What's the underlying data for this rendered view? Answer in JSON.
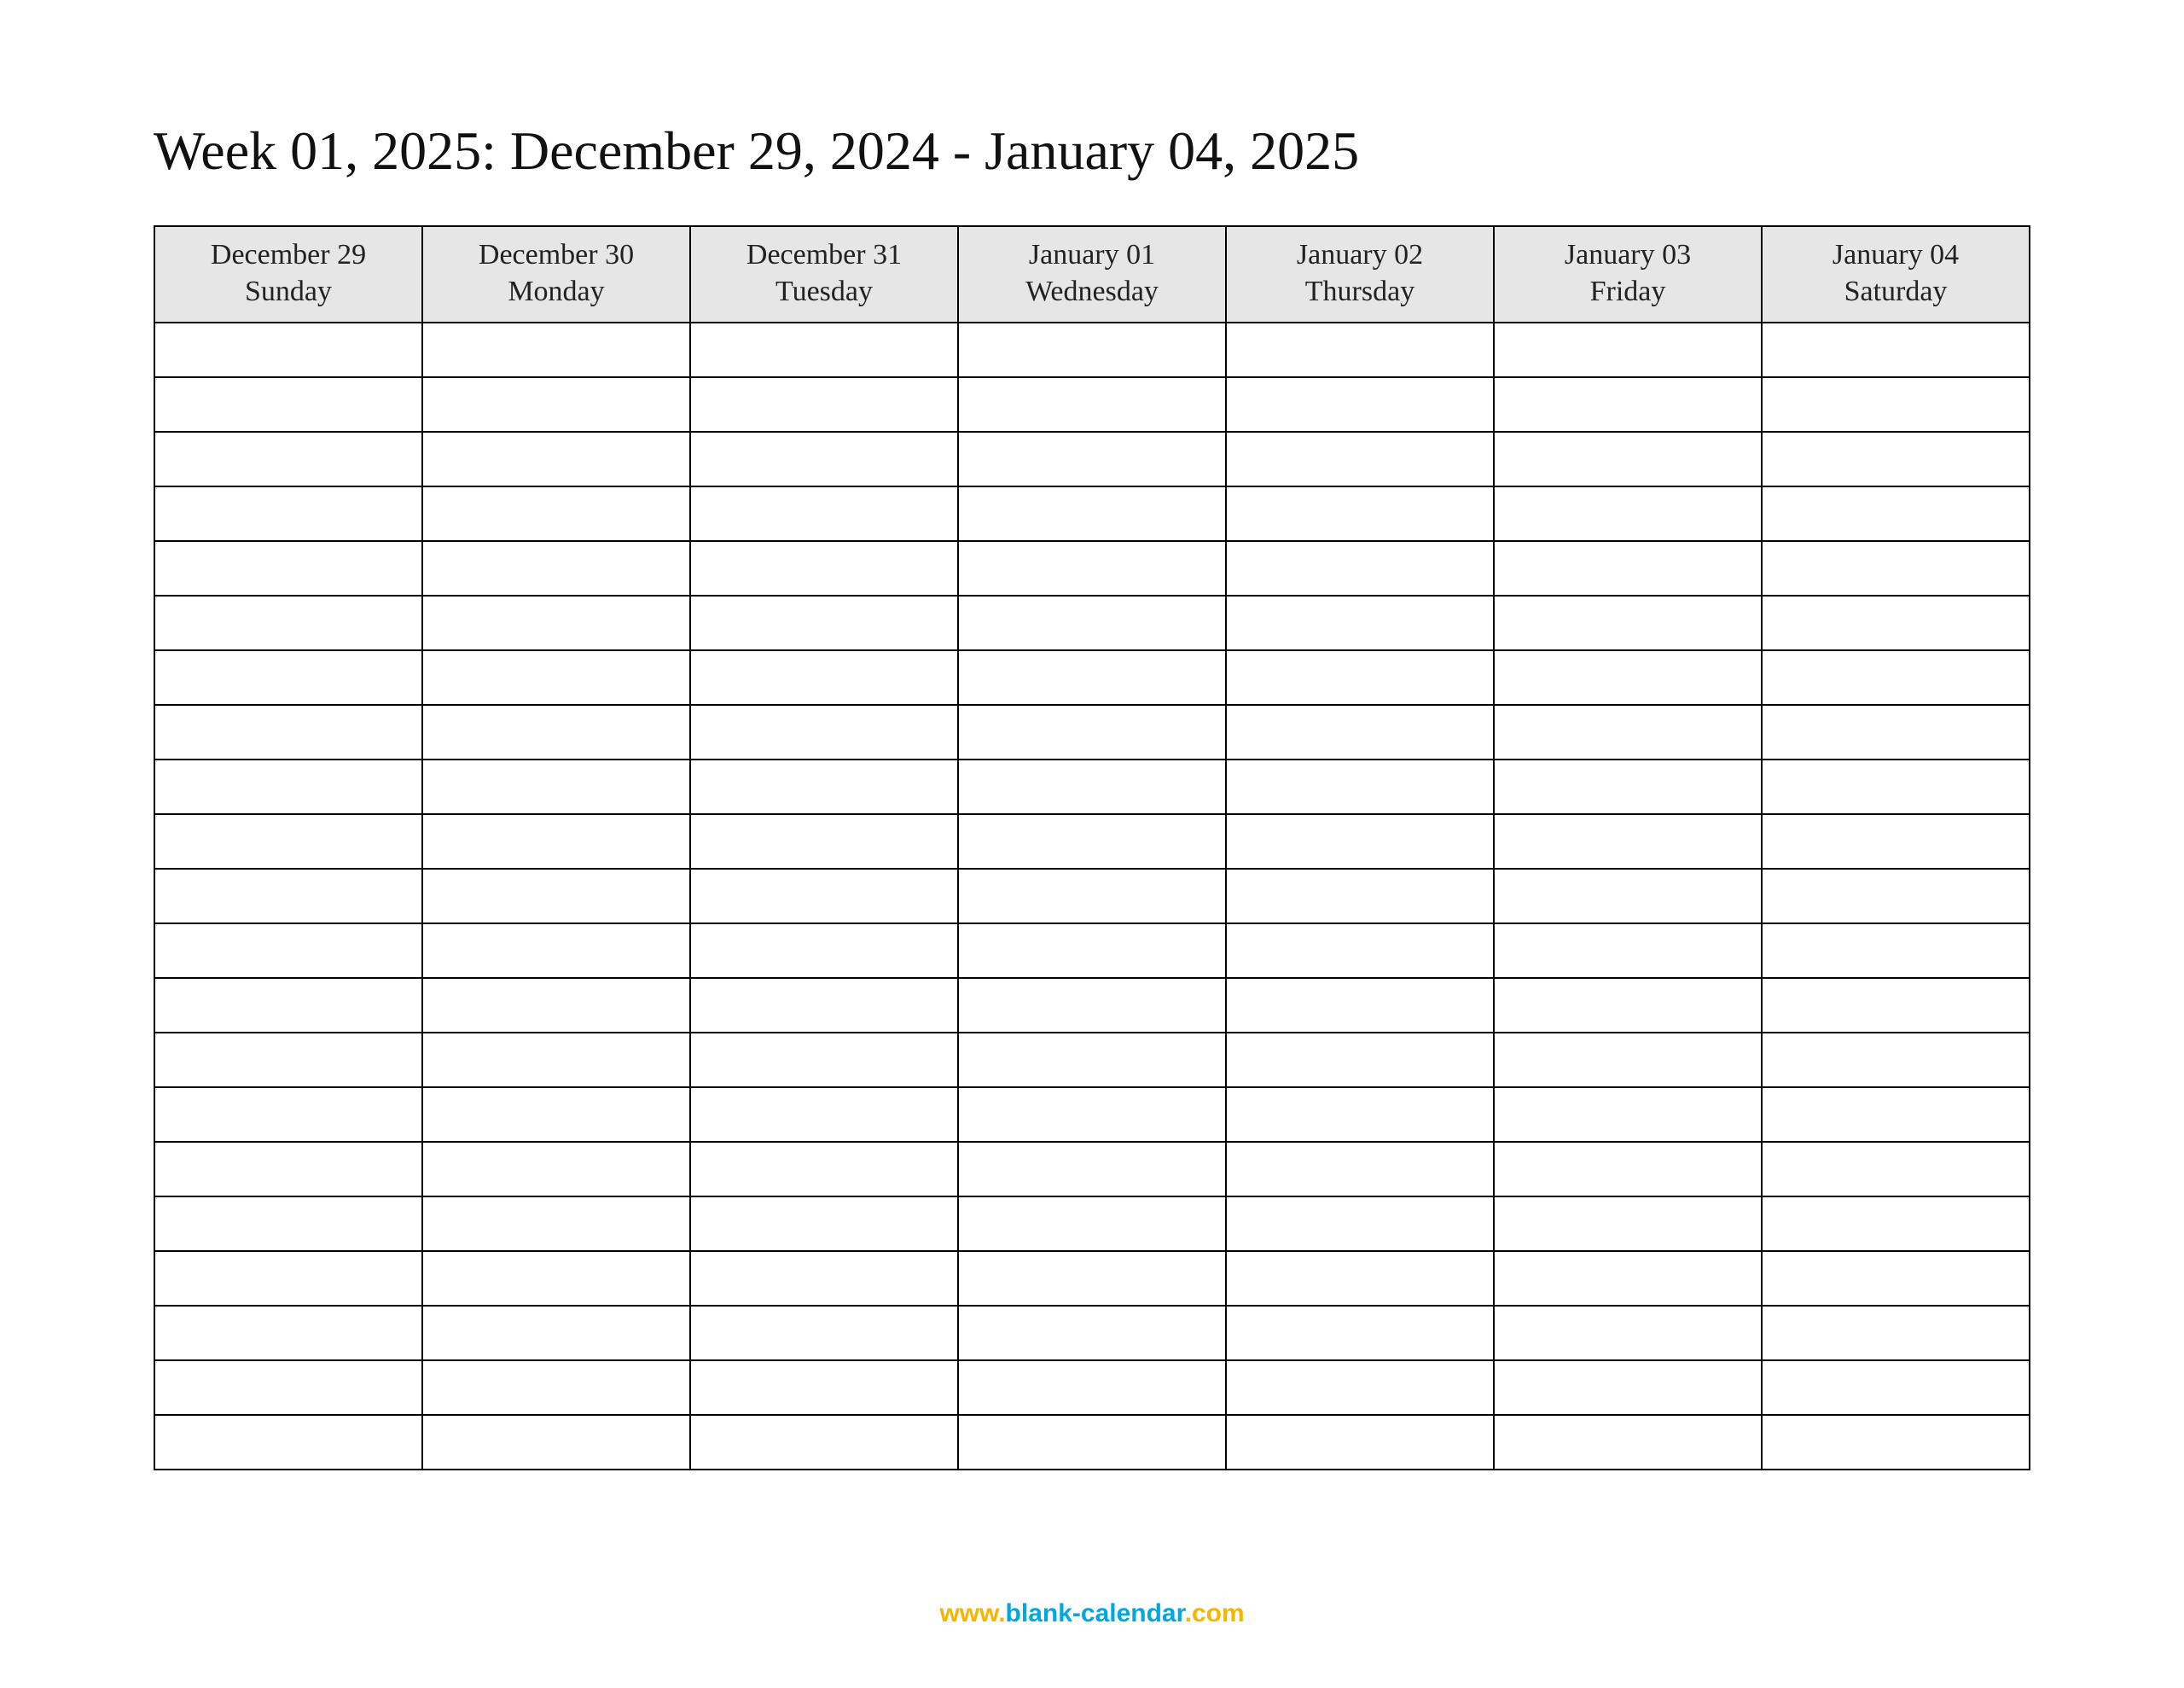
{
  "title": "Week 01, 2025: December 29, 2024 - January 04, 2025",
  "columns": [
    {
      "date": "December 29",
      "day": "Sunday"
    },
    {
      "date": "December 30",
      "day": "Monday"
    },
    {
      "date": "December 31",
      "day": "Tuesday"
    },
    {
      "date": "January 01",
      "day": "Wednesday"
    },
    {
      "date": "January 02",
      "day": "Thursday"
    },
    {
      "date": "January 03",
      "day": "Friday"
    },
    {
      "date": "January 04",
      "day": "Saturday"
    }
  ],
  "row_count": 21,
  "footer": {
    "www": "www.",
    "domain": "blank-calendar",
    "dotcom": ".com"
  }
}
